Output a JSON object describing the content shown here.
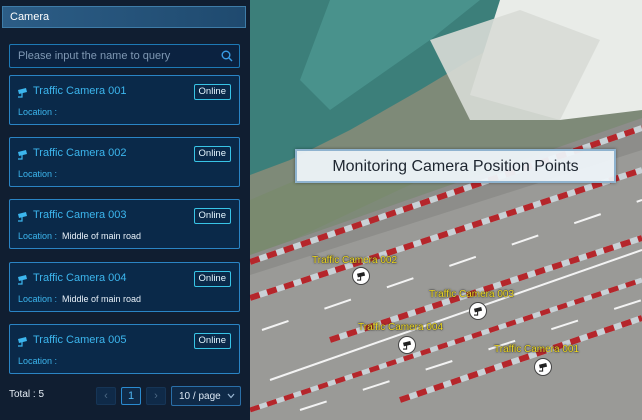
{
  "panel": {
    "title": "Camera",
    "search": {
      "placeholder": "Please input the name to query"
    },
    "location_label": "Location :",
    "cameras": [
      {
        "name": "Traffic Camera 001",
        "status": "Online",
        "location": ""
      },
      {
        "name": "Traffic Camera 002",
        "status": "Online",
        "location": ""
      },
      {
        "name": "Traffic Camera 003",
        "status": "Online",
        "location": "Middle of main road"
      },
      {
        "name": "Traffic Camera 004",
        "status": "Online",
        "location": "Middle of main road"
      },
      {
        "name": "Traffic Camera 005",
        "status": "Online",
        "location": ""
      }
    ],
    "pagination": {
      "total_text": "Total : 5",
      "prev": "‹",
      "current_page": "1",
      "next": "›",
      "page_size": "10 / page"
    }
  },
  "map": {
    "banner": "Monitoring Camera Position Points",
    "markers": [
      {
        "label": "Traffic Camera 002"
      },
      {
        "label": "Traffic Camera 003"
      },
      {
        "label": "Traffic Camera 004"
      },
      {
        "label": "Traffic Camera 001"
      }
    ]
  },
  "colors": {
    "accent": "#3cb6ee",
    "panel_bg": "#07162c",
    "label_yellow": "#f2dc24"
  },
  "icons": {
    "camera": "cctv-camera-icon",
    "search": "search-icon",
    "chevron": "chevron-down-icon"
  }
}
